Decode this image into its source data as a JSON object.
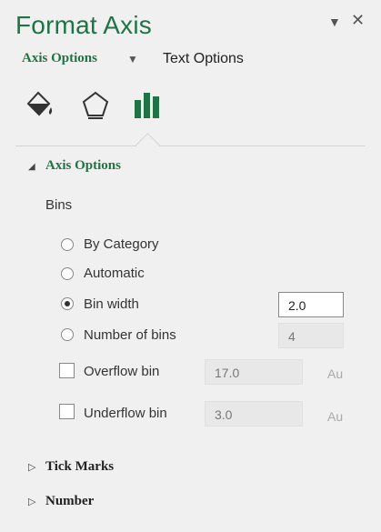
{
  "pane": {
    "title": "Format Axis",
    "dropdown_glyph": "▼",
    "close_glyph": "✕"
  },
  "tabs": {
    "axis_options": "Axis Options",
    "caret": "▼",
    "text_options": "Text Options"
  },
  "icons": [
    "fill-line-icon",
    "effects-icon",
    "axis-options-icon"
  ],
  "colors": {
    "accent": "#217346",
    "panel_bg": "#f0f0f0"
  },
  "axis_options_section": {
    "arrow": "◢",
    "title": "Axis Options",
    "bins_label": "Bins",
    "radios": {
      "by_category": "By Category",
      "automatic": "Automatic",
      "bin_width": "Bin width",
      "number_of_bins": "Number of bins"
    },
    "selected": "bin_width",
    "bin_width_value": "2.0",
    "number_of_bins_value": "4",
    "overflow_label": "Overflow bin",
    "overflow_value": "17.0",
    "overflow_auto": "Au",
    "underflow_label": "Underflow bin",
    "underflow_value": "3.0",
    "underflow_auto": "Au"
  },
  "collapsed_sections": {
    "arrow": "▷",
    "tick_marks": "Tick Marks",
    "number": "Number"
  }
}
